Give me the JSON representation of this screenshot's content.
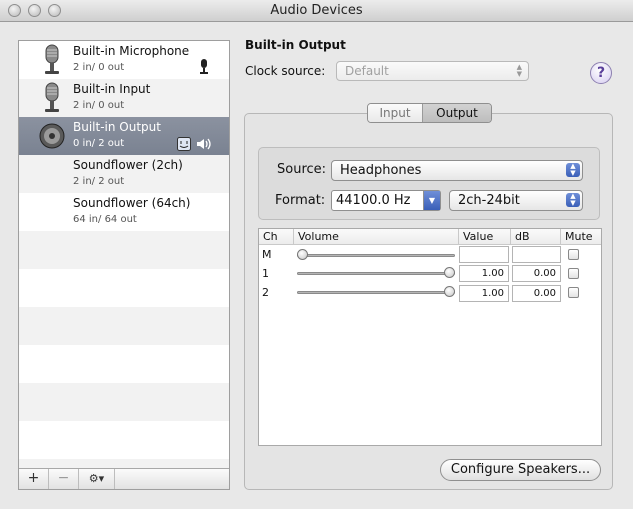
{
  "window": {
    "title": "Audio Devices"
  },
  "devices": [
    {
      "name": "Built-in Microphone",
      "io": "2 in/ 0 out",
      "icon": "microphone-icon",
      "badge": "microphone-small-icon",
      "selected": false
    },
    {
      "name": "Built-in Input",
      "io": "2 in/ 0 out",
      "icon": "microphone-icon",
      "selected": false
    },
    {
      "name": "Built-in Output",
      "io": "0 in/ 2 out",
      "icon": "speaker-icon",
      "badge": "finder-speaker-icons",
      "selected": true
    },
    {
      "name": "Soundflower (2ch)",
      "io": "2 in/ 2 out",
      "icon": "",
      "selected": false
    },
    {
      "name": "Soundflower (64ch)",
      "io": "64 in/ 64 out",
      "icon": "",
      "selected": false
    }
  ],
  "list_toolbar": {
    "add": "+",
    "remove": "−",
    "action": "⚙▾"
  },
  "detail": {
    "title": "Built-in Output",
    "clock_label": "Clock source:",
    "clock_value": "Default",
    "help": "?",
    "tabs": [
      {
        "label": "Input",
        "selected": false
      },
      {
        "label": "Output",
        "selected": true
      }
    ],
    "source_label": "Source:",
    "source_value": "Headphones",
    "format_label": "Format:",
    "format_rate": "44100.0 Hz",
    "format_bits": "2ch-24bit",
    "table": {
      "headers": {
        "ch": "Ch",
        "volume": "Volume",
        "value": "Value",
        "db": "dB",
        "mute": "Mute"
      },
      "rows": [
        {
          "ch": "M",
          "level": 0.0,
          "value": "",
          "db": "",
          "mute": false
        },
        {
          "ch": "1",
          "level": 1.0,
          "value": "1.00",
          "db": "0.00",
          "mute": false
        },
        {
          "ch": "2",
          "level": 1.0,
          "value": "1.00",
          "db": "0.00",
          "mute": false
        }
      ]
    },
    "configure_button": "Configure Speakers..."
  }
}
